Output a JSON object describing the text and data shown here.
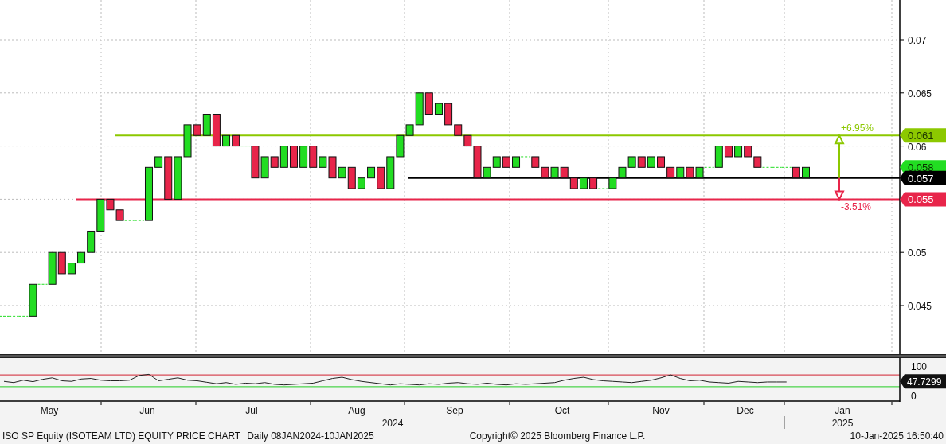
{
  "price_axis": {
    "ticks": [
      "0.07",
      "0.065",
      "0.06",
      "0.05",
      "0.045"
    ]
  },
  "level_tags": [
    {
      "kind": "resistance",
      "label": "0.061",
      "color": "#8cc800"
    },
    {
      "kind": "last",
      "label": "0.058",
      "color": "#22dd22"
    },
    {
      "kind": "base",
      "label": "0.057",
      "color": "#000000"
    },
    {
      "kind": "support",
      "label": "0.055",
      "color": "#e8254a"
    }
  ],
  "percent_labels": [
    {
      "kind": "up",
      "label": "+6.95%",
      "color": "#8cc800"
    },
    {
      "kind": "down",
      "label": "-3.51%",
      "color": "#e8254a"
    }
  ],
  "indicator": {
    "ticks": [
      "100",
      "0"
    ],
    "reading": "47.7299"
  },
  "months": [
    "May",
    "Jun",
    "Jul",
    "Aug",
    "Sep",
    "Oct",
    "Nov",
    "Dec",
    "Jan"
  ],
  "years": [
    "2024",
    "2025"
  ],
  "footer": {
    "title": "ISO SP Equity (ISOTEAM LTD) EQUITY PRICE CHART",
    "range": "Daily 08JAN2024-10JAN2025",
    "copyright": "Copyright© 2025 Bloomberg Finance L.P.",
    "timestamp": "10-Jan-2025 16:50:40"
  }
}
